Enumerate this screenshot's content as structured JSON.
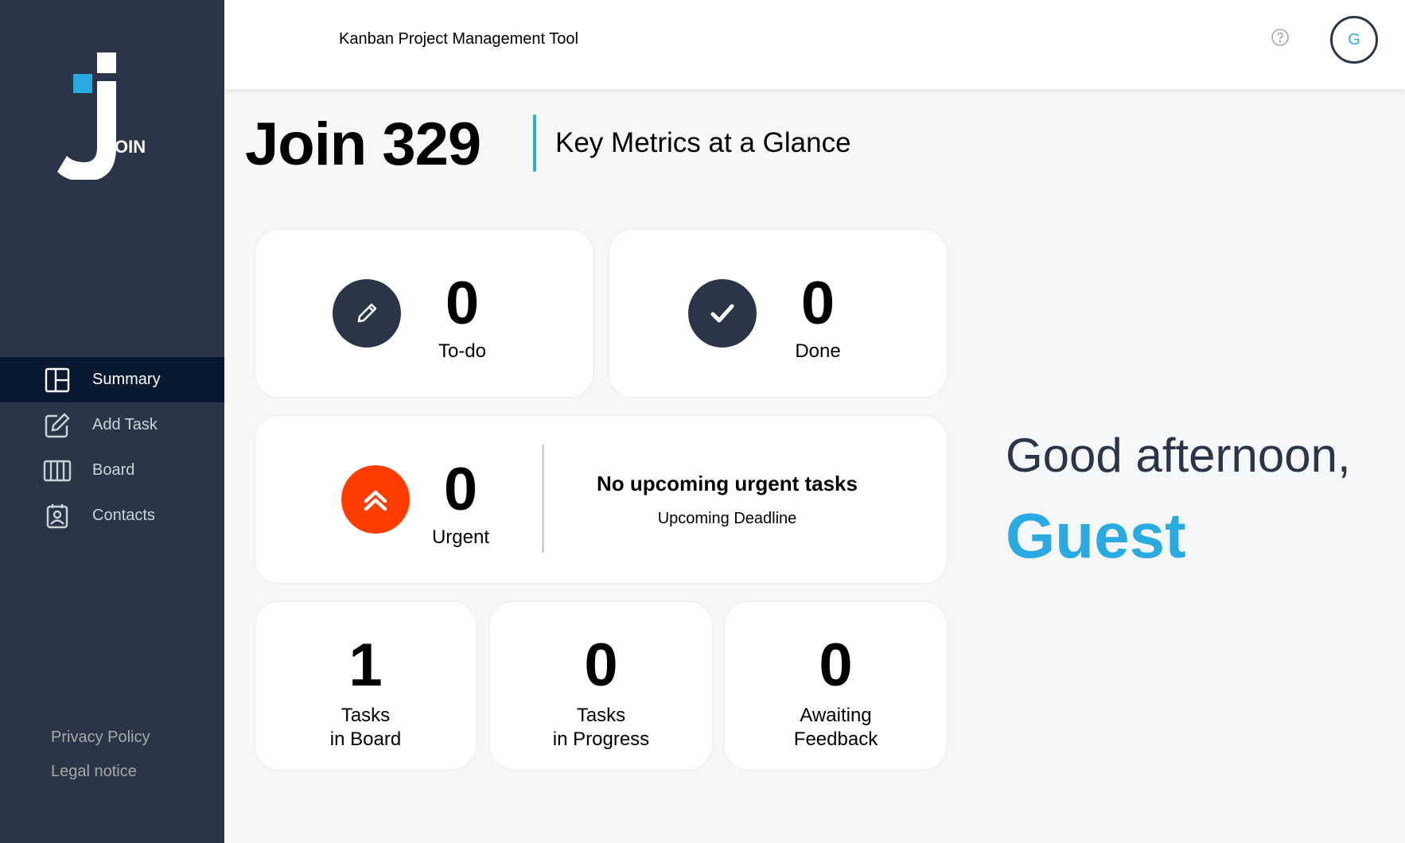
{
  "app": {
    "logo_text": "OIN",
    "header_title": "Kanban Project Management Tool",
    "user_initial": "G"
  },
  "sidebar": {
    "items": [
      {
        "label": "Summary",
        "icon": "summary-icon",
        "active": true
      },
      {
        "label": "Add Task",
        "icon": "add-task-icon",
        "active": false
      },
      {
        "label": "Board",
        "icon": "board-icon",
        "active": false
      },
      {
        "label": "Contacts",
        "icon": "contacts-icon",
        "active": false
      }
    ],
    "footer": {
      "privacy": "Privacy Policy",
      "legal": "Legal notice"
    }
  },
  "main": {
    "title": "Join 329",
    "subtitle": "Key Metrics at a Glance",
    "todo": {
      "count": "0",
      "label": "To-do",
      "icon": "pencil-icon"
    },
    "done": {
      "count": "0",
      "label": "Done",
      "icon": "check-icon"
    },
    "urgent": {
      "count": "0",
      "label": "Urgent",
      "icon": "double-chevron-up-icon",
      "deadline_text": "No upcoming urgent tasks",
      "deadline_label": "Upcoming Deadline"
    },
    "board": {
      "count": "1",
      "line1": "Tasks",
      "line2": "in Board"
    },
    "progress": {
      "count": "0",
      "line1": "Tasks",
      "line2": "in Progress"
    },
    "feedback": {
      "count": "0",
      "line1": "Awaiting",
      "line2": "Feedback"
    }
  },
  "greeting": {
    "text": "Good afternoon,",
    "name": "Guest"
  },
  "colors": {
    "sidebar_bg": "#2a3647",
    "active_nav_bg": "#091931",
    "accent": "#29abe2",
    "urgent": "#ff3d00",
    "page_bg": "#f6f7f8"
  }
}
